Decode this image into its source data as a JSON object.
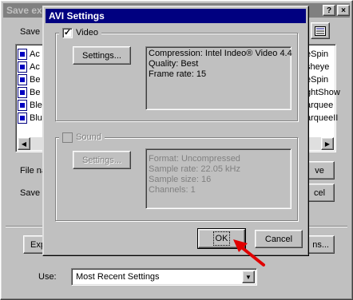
{
  "save_dialog": {
    "title": "Save exp",
    "help_button": "?",
    "close_button": "×",
    "save_in_label": "Save",
    "file_list_left": [
      "Ac",
      "Ac",
      "Be",
      "Be",
      "Ble",
      "Blu"
    ],
    "file_list_right": [
      "eSpin",
      "sheye",
      "eSpin",
      "ghtShow",
      "arquee",
      "arqueeII"
    ],
    "file_name_label": "File na",
    "save_as_label": "Save a",
    "save_button": "ve",
    "cancel_button": "cel",
    "export_button": "Exp",
    "options_button": "ns...",
    "use_label": "Use:",
    "use_value": "Most Recent Settings"
  },
  "avi_dialog": {
    "title": "AVI Settings",
    "close_button": "×",
    "video": {
      "checkbox_label": "Video",
      "checked": true,
      "settings_button": "Settings...",
      "info": [
        "Compression: Intel Indeo® Video 4.4",
        "Quality: Best",
        "Frame rate: 15"
      ]
    },
    "sound": {
      "checkbox_label": "Sound",
      "checked": false,
      "settings_button": "Settings...",
      "info": [
        "Format: Uncompressed",
        "Sample rate: 22.05 kHz",
        "Sample size: 16",
        "Channels: 1"
      ]
    },
    "ok_button": "OK",
    "cancel_button": "Cancel"
  },
  "colors": {
    "titlebar_active": "#000080",
    "titlebar_inactive": "#808080",
    "annotation_arrow": "#e00000"
  }
}
